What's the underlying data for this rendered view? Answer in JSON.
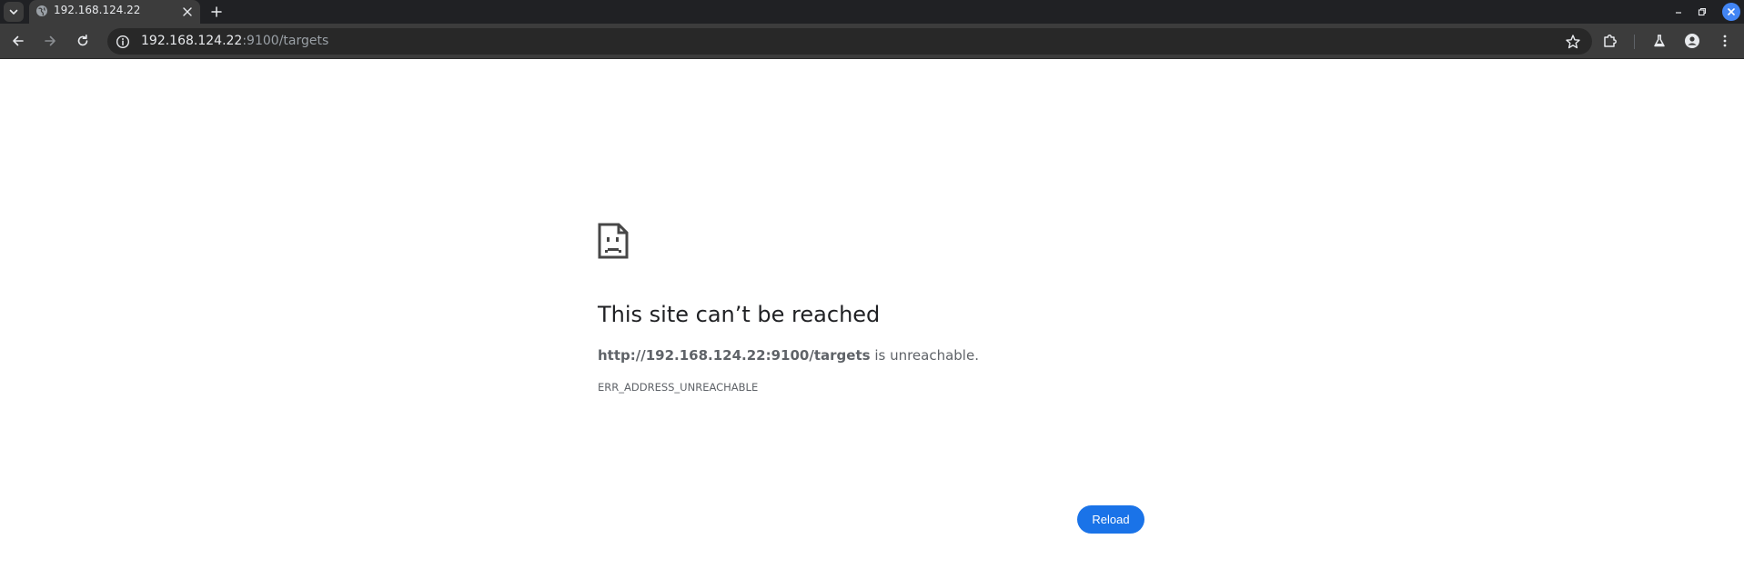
{
  "tab": {
    "title": "192.168.124.22"
  },
  "omnibox": {
    "host": "192.168.124.22",
    "path": ":9100/targets"
  },
  "error": {
    "title": "This site can’t be reached",
    "url": "http://192.168.124.22:9100/targets",
    "detail_suffix": " is unreachable.",
    "code": "ERR_ADDRESS_UNREACHABLE",
    "reload_label": "Reload"
  },
  "colors": {
    "accent": "#1a73e8",
    "tabstrip": "#202124",
    "toolbar": "#3c3c3c"
  },
  "icons": {
    "tab_search": "chevron-down-icon",
    "favicon": "globe-icon",
    "tab_close": "close-icon",
    "new_tab": "plus-icon",
    "back": "back-arrow-icon",
    "forward": "forward-arrow-icon",
    "reload": "reload-icon",
    "site_info": "info-icon",
    "bookmark": "star-icon",
    "extensions": "puzzle-icon",
    "labs": "flask-icon",
    "profile": "profile-icon",
    "menu": "kebab-menu-icon",
    "error": "sad-page-icon"
  }
}
